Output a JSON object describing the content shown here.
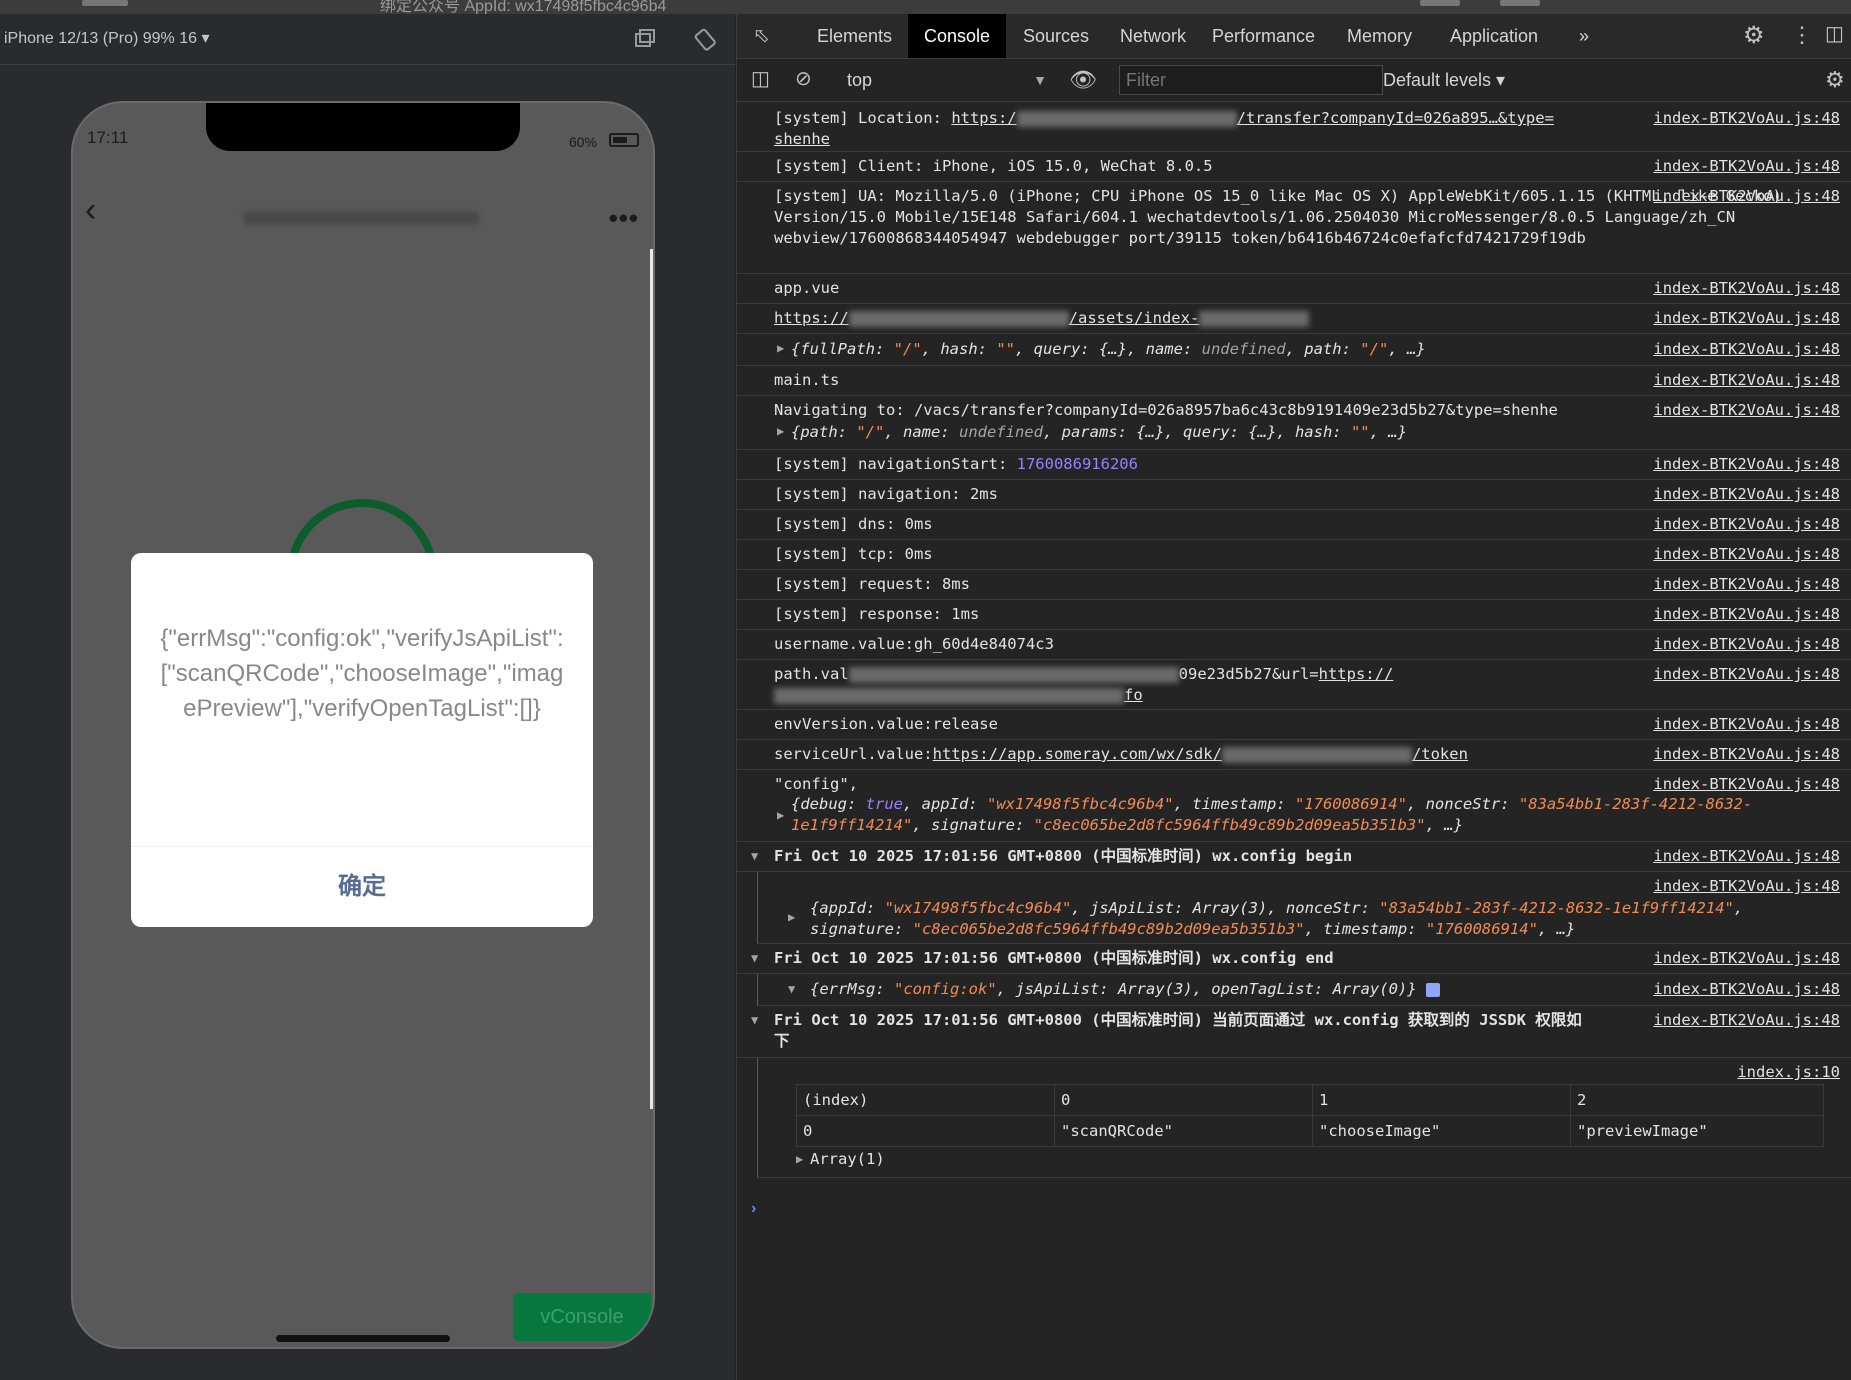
{
  "window": {
    "title": "绑定公众号 AppId: wx17498f5fbc4c96b4"
  },
  "simulator": {
    "device_label": "iPhone 12/13 (Pro) 99% 16 ▾",
    "status_time": "17:11",
    "battery": "60%",
    "modal": {
      "message": "{\"errMsg\":\"config:ok\",\"verifyJsApiList\":[\"scanQRCode\",\"chooseImage\",\"imagePreview\"],\"verifyOpenTagList\":[]}",
      "confirm": "确定"
    },
    "vconsole_label": "vConsole"
  },
  "devtools": {
    "tabs": [
      "Elements",
      "Console",
      "Sources",
      "Network",
      "Performance",
      "Memory",
      "Application"
    ],
    "active_tab": "Console",
    "more_tabs": "»",
    "context": "top",
    "filter_placeholder": "Filter",
    "levels": "Default levels ▾",
    "source_main": "index-BTK2VoAu.js:48",
    "source_alt": "index.js:10",
    "logs": {
      "location_prefix": "[system] Location: ",
      "location_link_a": "https:/",
      "location_link_b": "/transfer?companyId=026a895…&type=",
      "location_link_c": "shenhe",
      "client": "[system] Client: iPhone, iOS 15.0, WeChat 8.0.5",
      "ua": "[system] UA: Mozilla/5.0 (iPhone; CPU iPhone OS 15_0 like Mac OS X) AppleWebKit/605.1.15 (KHTML, like Gecko) Version/15.0 Mobile/15E148 Safari/604.1 wechatdevtools/1.06.2504030 MicroMessenger/8.0.5 Language/zh_CN webview/17600868344054947 webdebugger port/39115 token/b6416b46724c0efafcfd7421729f19db",
      "app_vue": "app.vue",
      "assets_a": "https://",
      "assets_b": "/assets/index-",
      "main_ts": "main.ts",
      "navigating": "Navigating to: /vacs/transfer?companyId=026a8957ba6c43c8b9191409e23d5b27&type=shenhe",
      "nav_start_label": "[system] navigationStart: ",
      "nav_start_value": "1760086916206",
      "navigation": "[system] navigation: 2ms",
      "dns": "[system] dns: 0ms",
      "tcp": "[system] tcp: 0ms",
      "request": "[system] request: 8ms",
      "response": "[system] response: 1ms",
      "username": "username.value:gh_60d4e84074c3",
      "path_a": "path.val",
      "path_b": "09e23d5b27&url=",
      "path_link": "https://",
      "path_c": "fo",
      "env": "envVersion.value:release",
      "service_a": "serviceUrl.value:",
      "service_link_a": "https://app.someray.com/wx/sdk/",
      "service_link_b": "/token",
      "config_label": "\"config\",",
      "group_begin": "Fri Oct 10 2025 17:01:56 GMT+0800 (中国标准时间) wx.config begin",
      "group_end": "Fri Oct 10 2025 17:01:56 GMT+0800 (中国标准时间) wx.config end",
      "group_jssdk": "Fri Oct 10 2025 17:01:56 GMT+0800 (中国标准时间) 当前页面通过 wx.config 获取到的 JSSDK 权限如下",
      "array_label": "Array(1)"
    },
    "table": {
      "headers": [
        "(index)",
        "0",
        "1",
        "2"
      ],
      "rows": [
        [
          "0",
          "\"scanQRCode\"",
          "\"chooseImage\"",
          "\"previewImage\""
        ]
      ]
    },
    "prompt": "›"
  },
  "colors": {
    "string": "#f28b54",
    "number": "#9980ff",
    "active_tab": "#000000",
    "vconsole": "#07773d"
  }
}
